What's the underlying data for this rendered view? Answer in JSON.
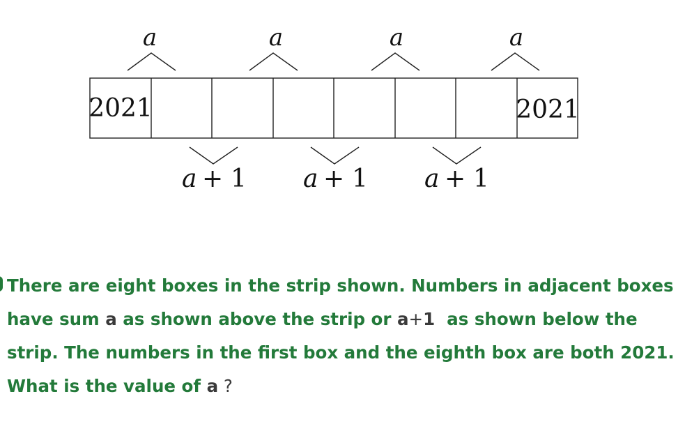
{
  "strip": {
    "boxes": [
      "2021",
      "",
      "",
      "",
      "",
      "",
      "",
      "2021"
    ]
  },
  "labels": {
    "above": "a",
    "below_var": "a",
    "below_plus": "+",
    "below_one": "1"
  },
  "question": {
    "line1": "There are eight boxes in the strip shown. Numbers in adjacent boxes",
    "line2_a": "have sum ",
    "line2_var": "a",
    "line2_b": " as shown above the strip or ",
    "line2_expr_var": "a",
    "line2_expr_plus": "+",
    "line2_expr_one": "1",
    "line2_c": "  as shown below the",
    "line3": "strip. The numbers in the first box and the eighth box are both 2021.",
    "line4_a": "What is the value of ",
    "line4_var": "a",
    "line4_q": " ?"
  }
}
